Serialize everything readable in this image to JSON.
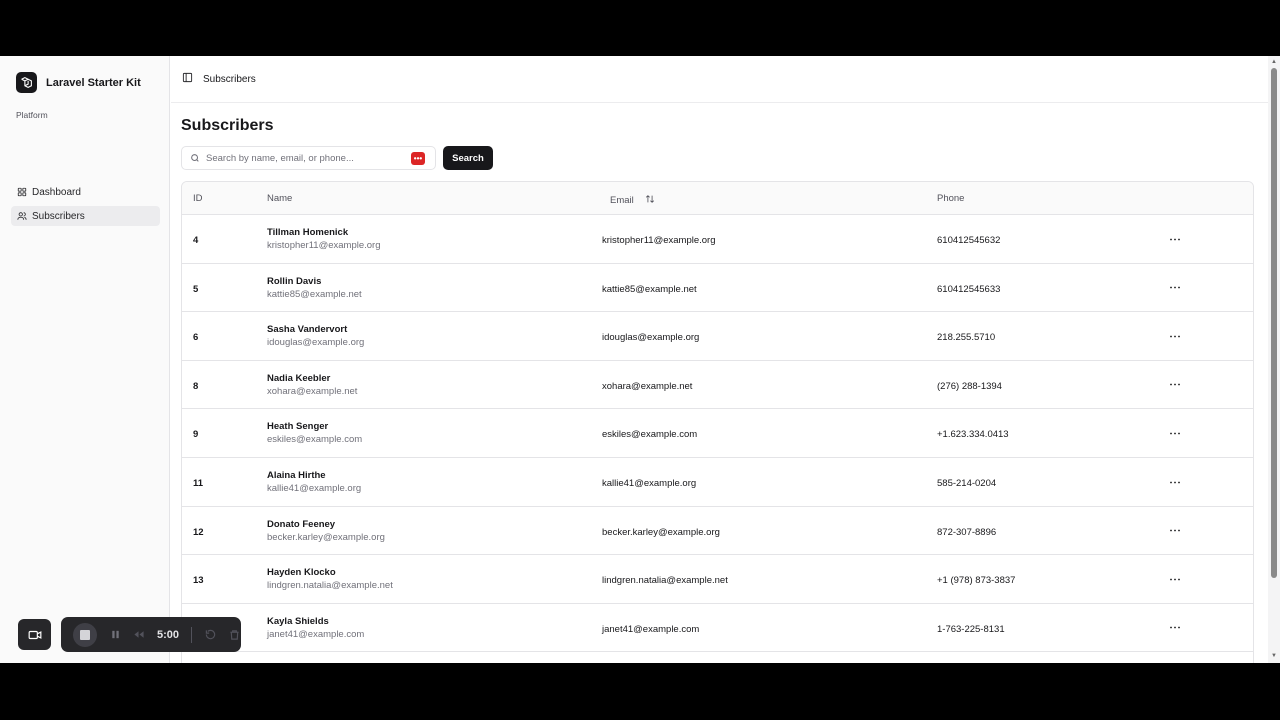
{
  "app": {
    "title": "Laravel Starter Kit"
  },
  "sidebar": {
    "group_label": "Platform",
    "items": [
      {
        "label": "Dashboard",
        "icon": "grid-icon",
        "active": false
      },
      {
        "label": "Subscribers",
        "icon": "users-icon",
        "active": true
      }
    ]
  },
  "header": {
    "breadcrumb": "Subscribers"
  },
  "page": {
    "title": "Subscribers"
  },
  "search": {
    "placeholder": "Search by name, email, or phone...",
    "value": "",
    "button_label": "Search"
  },
  "table": {
    "columns": {
      "id": "ID",
      "name": "Name",
      "email": "Email",
      "phone": "Phone"
    },
    "rows": [
      {
        "id": "4",
        "name": "Tillman Homenick",
        "email": "kristopher11@example.org",
        "phone": "610412545632"
      },
      {
        "id": "5",
        "name": "Rollin Davis",
        "email": "kattie85@example.net",
        "phone": "610412545633"
      },
      {
        "id": "6",
        "name": "Sasha Vandervort",
        "email": "idouglas@example.org",
        "phone": "218.255.5710"
      },
      {
        "id": "8",
        "name": "Nadia Keebler",
        "email": "xohara@example.net",
        "phone": "(276) 288-1394"
      },
      {
        "id": "9",
        "name": "Heath Senger",
        "email": "eskiles@example.com",
        "phone": "+1.623.334.0413"
      },
      {
        "id": "11",
        "name": "Alaina Hirthe",
        "email": "kallie41@example.org",
        "phone": "585-214-0204"
      },
      {
        "id": "12",
        "name": "Donato Feeney",
        "email": "becker.karley@example.org",
        "phone": "872-307-8896"
      },
      {
        "id": "13",
        "name": "Hayden Klocko",
        "email": "lindgren.natalia@example.net",
        "phone": "+1 (978) 873-3837"
      },
      {
        "id": "",
        "name": "Kayla Shields",
        "email": "janet41@example.com",
        "phone": "1-763-225-8131"
      }
    ]
  },
  "recorder": {
    "time": "5:00"
  },
  "colors": {
    "accent": "#18181b",
    "badge": "#dc2626"
  }
}
